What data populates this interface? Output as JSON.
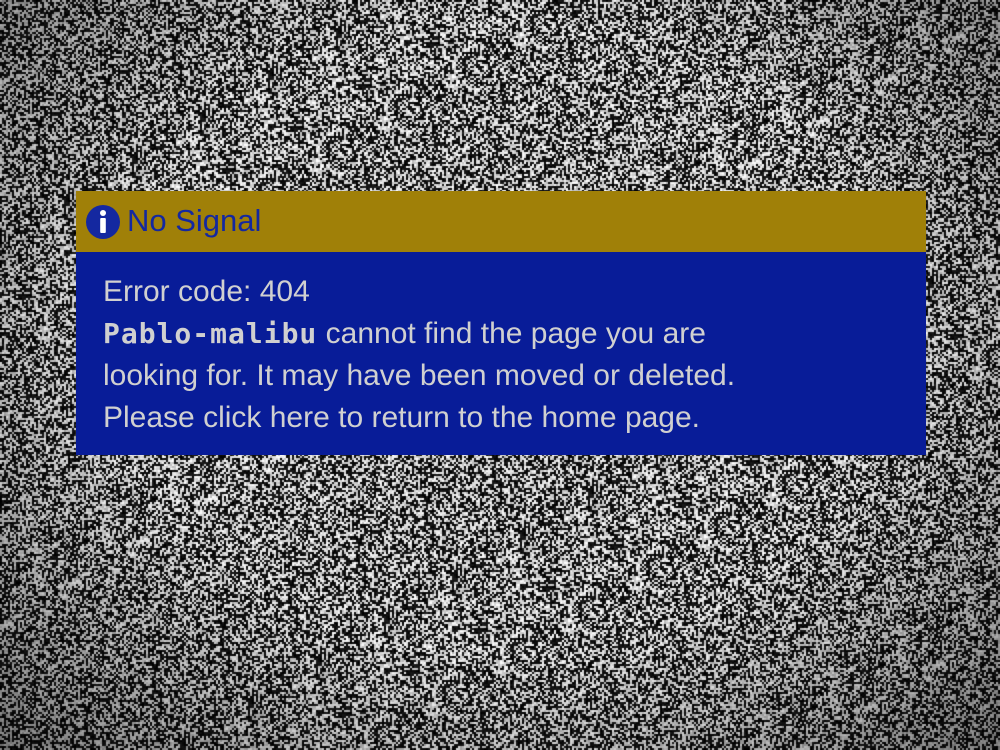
{
  "dialog": {
    "title": "No Signal",
    "icon": "info-icon",
    "error_line": "Error code: 404",
    "site_name": "Pablo-malibu",
    "message_part1": "cannot find the page you are",
    "message_part2": "looking for. It may have been moved or deleted.",
    "home_link": "Please click here to return to the home page."
  },
  "colors": {
    "title_bar": "#a08008",
    "title_text": "#1428a0",
    "body_panel": "#081c98",
    "body_text": "#d0d0d0"
  }
}
